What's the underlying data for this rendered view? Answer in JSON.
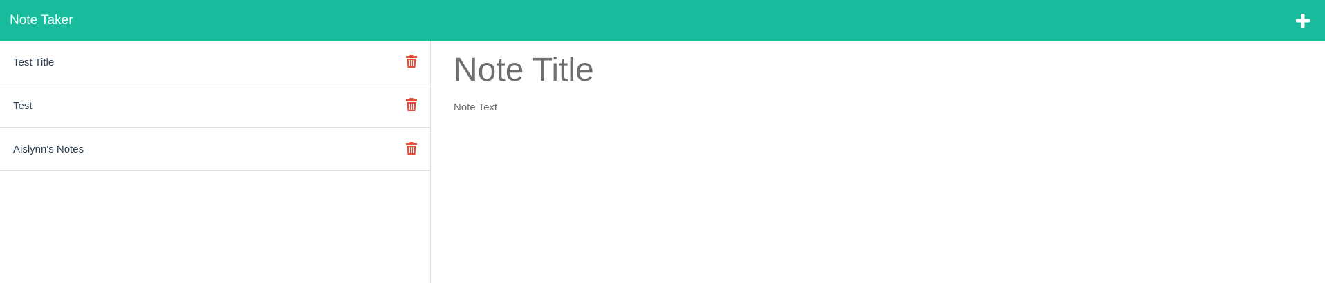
{
  "app": {
    "brand": "Note Taker",
    "accent_color": "#18bc9c",
    "add_icon": "plus-icon"
  },
  "sidebar": {
    "delete_icon": "trash-icon",
    "delete_color": "#e74c3c",
    "notes": [
      {
        "title": "Test Title"
      },
      {
        "title": "Test"
      },
      {
        "title": "Aislynn's Notes"
      }
    ]
  },
  "editor": {
    "title_placeholder": "Note Title",
    "text_placeholder": "Note Text",
    "title_value": "",
    "text_value": ""
  }
}
